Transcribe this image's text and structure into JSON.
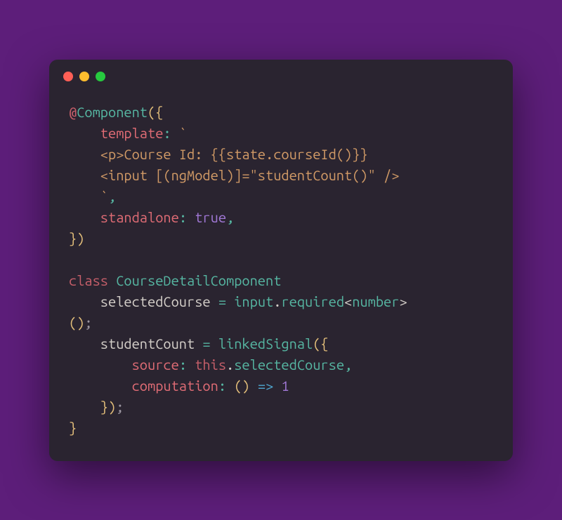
{
  "colors": {
    "background": "#5d1e7a",
    "window_bg": "#2a2430",
    "dot_red": "#ff5f56",
    "dot_yellow": "#ffbd2e",
    "dot_green": "#27c93f"
  },
  "code": {
    "tokens": [
      {
        "t": "@",
        "c": "red"
      },
      {
        "t": "Component",
        "c": "teal"
      },
      {
        "t": "({",
        "c": "yellow"
      },
      {
        "t": "\n",
        "c": "plain"
      },
      {
        "t": "    template",
        "c": "redlt"
      },
      {
        "t": ": ",
        "c": "teal"
      },
      {
        "t": "`",
        "c": "orange"
      },
      {
        "t": "\n",
        "c": "plain"
      },
      {
        "t": "    <p>Course Id: {{state.courseId()}}",
        "c": "orange"
      },
      {
        "t": "\n",
        "c": "plain"
      },
      {
        "t": "    <input [(ngModel)]=\"studentCount()\" />",
        "c": "orange"
      },
      {
        "t": "\n",
        "c": "plain"
      },
      {
        "t": "    `",
        "c": "orange"
      },
      {
        "t": ",",
        "c": "teal"
      },
      {
        "t": "\n",
        "c": "plain"
      },
      {
        "t": "    standalone",
        "c": "redlt"
      },
      {
        "t": ": ",
        "c": "teal"
      },
      {
        "t": "true",
        "c": "purple"
      },
      {
        "t": ",",
        "c": "teal"
      },
      {
        "t": "\n",
        "c": "plain"
      },
      {
        "t": "})",
        "c": "yellow"
      },
      {
        "t": "\n",
        "c": "plain"
      },
      {
        "t": "\n",
        "c": "plain"
      },
      {
        "t": "class ",
        "c": "red"
      },
      {
        "t": "CourseDetailComponent",
        "c": "teal"
      },
      {
        "t": "\n",
        "c": "plain"
      },
      {
        "t": "    selectedCourse ",
        "c": "plain"
      },
      {
        "t": "= ",
        "c": "teal"
      },
      {
        "t": "input",
        "c": "teal"
      },
      {
        "t": ".",
        "c": "plain"
      },
      {
        "t": "required",
        "c": "teal"
      },
      {
        "t": "<",
        "c": "plain"
      },
      {
        "t": "number",
        "c": "teal"
      },
      {
        "t": ">",
        "c": "plain"
      },
      {
        "t": "\n",
        "c": "plain"
      },
      {
        "t": "()",
        "c": "yellow"
      },
      {
        "t": ";",
        "c": "gray"
      },
      {
        "t": "\n",
        "c": "plain"
      },
      {
        "t": "    studentCount ",
        "c": "plain"
      },
      {
        "t": "= ",
        "c": "teal"
      },
      {
        "t": "linkedSignal",
        "c": "teal"
      },
      {
        "t": "({",
        "c": "yellow"
      },
      {
        "t": "\n",
        "c": "plain"
      },
      {
        "t": "        source",
        "c": "redlt"
      },
      {
        "t": ": ",
        "c": "teal"
      },
      {
        "t": "this",
        "c": "red"
      },
      {
        "t": ".",
        "c": "plain"
      },
      {
        "t": "selectedCourse",
        "c": "teal"
      },
      {
        "t": ",",
        "c": "teal"
      },
      {
        "t": "\n",
        "c": "plain"
      },
      {
        "t": "        computation",
        "c": "redlt"
      },
      {
        "t": ": ",
        "c": "teal"
      },
      {
        "t": "() ",
        "c": "yellow"
      },
      {
        "t": "=> ",
        "c": "blue"
      },
      {
        "t": "1",
        "c": "purple"
      },
      {
        "t": "\n",
        "c": "plain"
      },
      {
        "t": "    })",
        "c": "yellow"
      },
      {
        "t": ";",
        "c": "gray"
      },
      {
        "t": "\n",
        "c": "plain"
      },
      {
        "t": "}",
        "c": "yellow"
      }
    ]
  }
}
